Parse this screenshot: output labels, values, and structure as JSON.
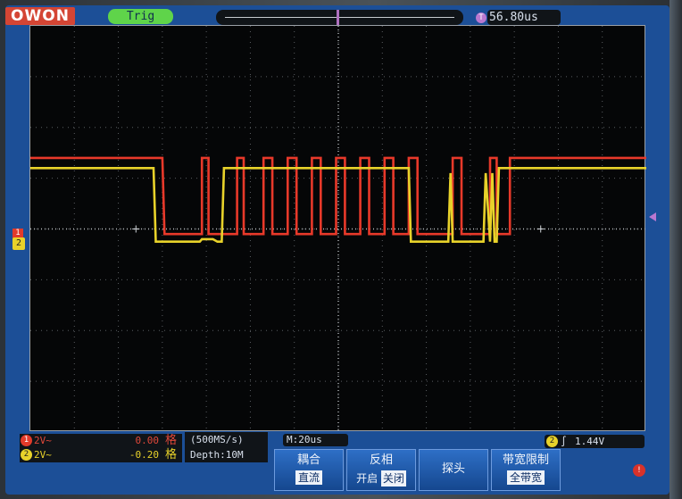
{
  "header": {
    "brand": "OWON",
    "trigger_status": "Trig",
    "trigger_position_label": "T",
    "trigger_position_value": "56.80us"
  },
  "channels": [
    {
      "id": "1",
      "scale": "2V~",
      "offset": "0.00",
      "unit": "格",
      "color": "#e23a2a"
    },
    {
      "id": "2",
      "scale": "2V~",
      "offset": "-0.20",
      "unit": "格",
      "color": "#e8d22a"
    }
  ],
  "acquisition": {
    "sample_rate": "(500MS/s)",
    "depth": "Depth:10M",
    "timebase": "M:20us"
  },
  "trigger": {
    "source": "2",
    "edge_symbol": "∫",
    "level": "1.44V"
  },
  "softkeys": [
    {
      "title": "耦合",
      "value": "直流"
    },
    {
      "title": "反相",
      "option_a": "开启",
      "option_b": "关闭",
      "selected": "option_b"
    },
    {
      "title": "探头"
    },
    {
      "title": "带宽限制",
      "value": "全带宽"
    }
  ],
  "markers": {
    "ch1": "1",
    "ch2": "2",
    "trigger_top": "T",
    "power": "!"
  },
  "chart_data": {
    "type": "line",
    "x_unit": "div",
    "y_unit": "div",
    "xlim": [
      0,
      14
    ],
    "ylim": [
      -4,
      4
    ],
    "grid": true,
    "series": [
      {
        "name": "",
        "color": "#e8392a",
        "points": [
          [
            0,
            1.4
          ],
          [
            3.0,
            1.4
          ],
          [
            3.05,
            -0.1
          ],
          [
            3.9,
            -0.1
          ],
          [
            3.9,
            1.4
          ],
          [
            4.05,
            1.4
          ],
          [
            4.05,
            -0.1
          ],
          [
            4.7,
            -0.1
          ],
          [
            4.7,
            1.4
          ],
          [
            4.85,
            1.4
          ],
          [
            4.85,
            -0.1
          ],
          [
            5.3,
            -0.1
          ],
          [
            5.3,
            1.4
          ],
          [
            5.5,
            1.4
          ],
          [
            5.5,
            -0.1
          ],
          [
            5.85,
            -0.1
          ],
          [
            5.85,
            1.4
          ],
          [
            6.05,
            1.4
          ],
          [
            6.05,
            -0.1
          ],
          [
            6.4,
            -0.1
          ],
          [
            6.4,
            1.4
          ],
          [
            6.6,
            1.4
          ],
          [
            6.6,
            -0.1
          ],
          [
            6.95,
            -0.1
          ],
          [
            6.95,
            1.4
          ],
          [
            7.15,
            1.4
          ],
          [
            7.15,
            -0.1
          ],
          [
            7.5,
            -0.1
          ],
          [
            7.5,
            1.4
          ],
          [
            7.7,
            1.4
          ],
          [
            7.7,
            -0.1
          ],
          [
            8.05,
            -0.1
          ],
          [
            8.05,
            1.4
          ],
          [
            8.25,
            1.4
          ],
          [
            8.25,
            -0.1
          ],
          [
            8.6,
            -0.1
          ],
          [
            8.6,
            1.4
          ],
          [
            8.8,
            1.4
          ],
          [
            8.8,
            -0.1
          ],
          [
            9.6,
            -0.1
          ],
          [
            9.6,
            1.4
          ],
          [
            9.8,
            1.4
          ],
          [
            9.8,
            -0.1
          ],
          [
            10.45,
            -0.1
          ],
          [
            10.45,
            1.4
          ],
          [
            10.6,
            1.4
          ],
          [
            10.6,
            -0.1
          ],
          [
            10.9,
            -0.1
          ],
          [
            10.9,
            1.4
          ],
          [
            14,
            1.4
          ]
        ]
      },
      {
        "name": "",
        "color": "#e8d22a",
        "points": [
          [
            0,
            1.2
          ],
          [
            2.8,
            1.2
          ],
          [
            2.85,
            -0.25
          ],
          [
            3.85,
            -0.25
          ],
          [
            3.9,
            -0.2
          ],
          [
            4.15,
            -0.2
          ],
          [
            4.25,
            -0.25
          ],
          [
            4.35,
            -0.25
          ],
          [
            4.4,
            1.2
          ],
          [
            8.6,
            1.2
          ],
          [
            8.65,
            -0.25
          ],
          [
            9.5,
            -0.25
          ],
          [
            9.55,
            1.1
          ],
          [
            9.6,
            -0.25
          ],
          [
            10.3,
            -0.25
          ],
          [
            10.35,
            1.1
          ],
          [
            10.45,
            -0.25
          ],
          [
            10.5,
            1.1
          ],
          [
            10.55,
            -0.25
          ],
          [
            10.6,
            -0.25
          ],
          [
            10.65,
            1.2
          ],
          [
            14,
            1.2
          ]
        ]
      }
    ]
  }
}
